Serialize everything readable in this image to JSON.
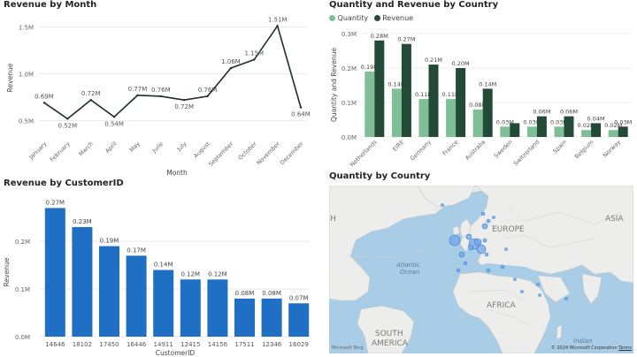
{
  "colors": {
    "quantity": "#7fbf97",
    "revenue": "#224a36",
    "customer_bar": "#1f6fc5",
    "line": "#1e2e24",
    "sea": "#a9cde6",
    "land": "#ededeb",
    "bubble": "#6fa6e8"
  },
  "revenue_by_month": {
    "title": "Revenue by Month",
    "chart_data": {
      "type": "line",
      "xlabel": "Month",
      "ylabel": "Revenue",
      "categories": [
        "January",
        "February",
        "March",
        "April",
        "May",
        "June",
        "July",
        "August",
        "September",
        "October",
        "November",
        "December"
      ],
      "values": [
        0.69,
        0.52,
        0.72,
        0.54,
        0.77,
        0.76,
        0.72,
        0.76,
        1.06,
        1.15,
        1.51,
        0.64
      ],
      "data_labels": [
        "0.69M",
        "0.52M",
        "0.72M",
        "0.54M",
        "0.77M",
        "0.76M",
        "0.72M",
        "0.76M",
        "1.06M",
        "1.15M",
        "1.51M",
        "0.64M"
      ],
      "y_ticks": [
        {
          "v": 0.5,
          "label": "0.5M"
        },
        {
          "v": 1.0,
          "label": "1.0M"
        },
        {
          "v": 1.5,
          "label": "1.5M"
        }
      ],
      "ylim": [
        0.42,
        1.56
      ]
    }
  },
  "quantity_revenue_country": {
    "title": "Quantity and Revenue by Country",
    "chart_data": {
      "type": "bar",
      "ylabel": "Quantity and Revenue",
      "categories": [
        "Netherlands",
        "EIRE",
        "Germany",
        "France",
        "Australia",
        "Sweden",
        "Switzerland",
        "Spain",
        "Belgium",
        "Norway"
      ],
      "series": [
        {
          "name": "Quantity",
          "values": [
            0.19,
            0.14,
            0.11,
            0.11,
            0.08,
            0.03,
            0.03,
            0.03,
            0.02,
            0.02
          ],
          "labels": [
            "0.19M",
            "0.14M",
            "0.11M",
            "0.11M",
            "0.08M",
            "0.03M",
            "0.03M",
            "0.03M",
            "0.02M",
            "0.02M"
          ]
        },
        {
          "name": "Revenue",
          "values": [
            0.28,
            0.27,
            0.21,
            0.2,
            0.14,
            0.04,
            0.06,
            0.06,
            0.04,
            0.03
          ],
          "labels": [
            "0.28M",
            "0.27M",
            "0.21M",
            "0.20M",
            "0.14M",
            "",
            "0.06M",
            "0.06M",
            "0.04M",
            "0.03M"
          ]
        }
      ],
      "y_ticks": [
        {
          "v": 0,
          "label": "0.0M"
        },
        {
          "v": 0.1,
          "label": "0.1M"
        },
        {
          "v": 0.2,
          "label": "0.2M"
        },
        {
          "v": 0.3,
          "label": "0.3M"
        }
      ],
      "ylim": [
        0,
        0.3
      ]
    }
  },
  "revenue_by_customer": {
    "title": "Revenue by CustomerID",
    "chart_data": {
      "type": "bar",
      "xlabel": "CustomerID",
      "ylabel": "Revenue",
      "categories": [
        "14646",
        "18102",
        "17450",
        "16446",
        "14911",
        "12415",
        "14156",
        "17511",
        "12346",
        "16029"
      ],
      "values": [
        0.27,
        0.23,
        0.19,
        0.17,
        0.14,
        0.12,
        0.12,
        0.08,
        0.08,
        0.07
      ],
      "data_labels": [
        "0.27M",
        "0.23M",
        "0.19M",
        "0.17M",
        "0.14M",
        "0.12M",
        "0.12M",
        "0.08M",
        "0.08M",
        "0.07M"
      ],
      "y_ticks": [
        {
          "v": 0,
          "label": "0.0M"
        },
        {
          "v": 0.1,
          "label": "0.1M"
        },
        {
          "v": 0.2,
          "label": "0.2M"
        }
      ],
      "ylim": [
        0,
        0.28
      ]
    }
  },
  "quantity_by_country": {
    "title": "Quantity by Country",
    "labels": {
      "asia": "ASIA",
      "europe": "EUROPE",
      "atlantic": "Atlantic",
      "ocean": "Ocean",
      "africa": "AFRICA",
      "south": "SOUTH",
      "america": "AMERICA",
      "indian": "Indian",
      "h_label": "H"
    },
    "attribution": "© 2024 Microsoft Corporation",
    "terms": "Terms",
    "bing": "Microsoft Bing"
  }
}
